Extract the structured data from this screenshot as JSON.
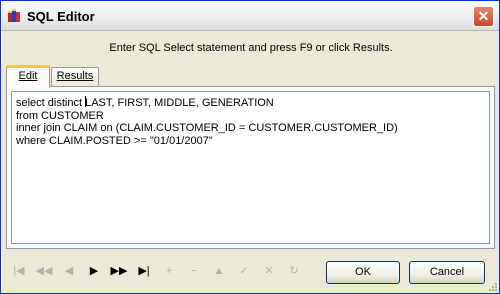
{
  "window": {
    "title": "SQL Editor",
    "close_glyph": "✕"
  },
  "instruction": "Enter SQL Select statement and press F9 or click Results.",
  "tabs": [
    {
      "label": "Edit",
      "active": true
    },
    {
      "label": "Results",
      "active": false
    }
  ],
  "editor": {
    "lines": [
      "select distinct LAST, FIRST, MIDDLE, GENERATION",
      "from CUSTOMER",
      "inner join CLAIM on (CLAIM.CUSTOMER_ID = CUSTOMER.CUSTOMER_ID)",
      "where CLAIM.POSTED >= \"01/01/2007\""
    ]
  },
  "navigator": [
    {
      "name": "first",
      "glyph": "|◀",
      "enabled": false
    },
    {
      "name": "prior-page",
      "glyph": "◀◀",
      "enabled": false
    },
    {
      "name": "prior",
      "glyph": "◀",
      "enabled": false
    },
    {
      "name": "next",
      "glyph": "▶",
      "enabled": true
    },
    {
      "name": "next-page",
      "glyph": "▶▶",
      "enabled": true
    },
    {
      "name": "last",
      "glyph": "▶|",
      "enabled": true
    },
    {
      "name": "insert",
      "glyph": "+",
      "enabled": false
    },
    {
      "name": "delete",
      "glyph": "−",
      "enabled": false
    },
    {
      "name": "edit",
      "glyph": "▲",
      "enabled": false
    },
    {
      "name": "post",
      "glyph": "✓",
      "enabled": false
    },
    {
      "name": "cancel",
      "glyph": "✕",
      "enabled": false
    },
    {
      "name": "refresh",
      "glyph": "↻",
      "enabled": false
    }
  ],
  "buttons": {
    "ok": "OK",
    "cancel": "Cancel"
  },
  "colors": {
    "titlebar": "#f2f2f2",
    "close": "#c8482a",
    "tab_highlight": "#ffc83c",
    "disabled": "#b4b4ad"
  }
}
